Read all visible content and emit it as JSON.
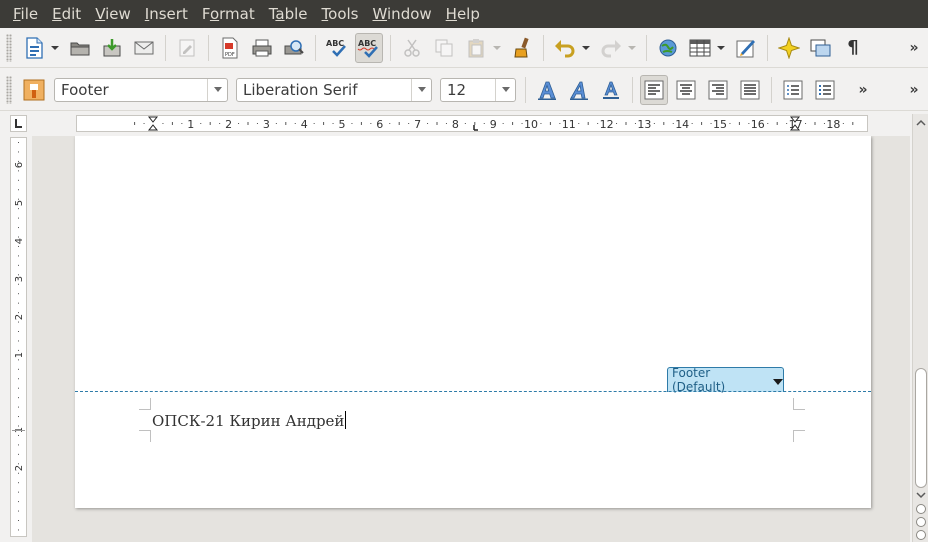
{
  "menu": {
    "file": {
      "mnemonic": "F",
      "rest": "ile"
    },
    "edit": {
      "mnemonic": "E",
      "rest": "dit"
    },
    "view": {
      "mnemonic": "V",
      "rest": "iew"
    },
    "insert": {
      "mnemonic": "I",
      "rest": "nsert"
    },
    "format_pre": "F",
    "format_mnemonic": "o",
    "format_rest": "rmat",
    "table_pre": "T",
    "table_mnemonic": "a",
    "table_rest": "ble",
    "tools": {
      "mnemonic": "T",
      "rest": "ools"
    },
    "window": {
      "mnemonic": "W",
      "rest": "indow"
    },
    "help": {
      "mnemonic": "H",
      "rest": "elp"
    }
  },
  "formatting": {
    "paragraph_style": "Footer",
    "font_name": "Liberation Serif",
    "font_size": "12"
  },
  "ruler": {
    "h_ticks": [
      "1",
      "2",
      "3",
      "4",
      "5",
      "6",
      "7",
      "8",
      "9",
      "10",
      "11",
      "12",
      "13",
      "14",
      "15",
      "16",
      "17",
      "18"
    ],
    "v_ticks": [
      "6",
      "5",
      "4",
      "3",
      "2",
      "1",
      "1",
      "2"
    ]
  },
  "toolbar": {
    "more_symbol": "»",
    "spellcheck_label": "ABC",
    "pilcrow": "¶"
  },
  "document": {
    "footer_tab_label": "Footer (Default)",
    "footer_text": "ОПСК-21 Кирин Андрей"
  },
  "colors": {
    "menubar": "#3c3b37",
    "footer_accent": "#2e7ba8",
    "footer_tab_bg": "#bfe3f5"
  }
}
